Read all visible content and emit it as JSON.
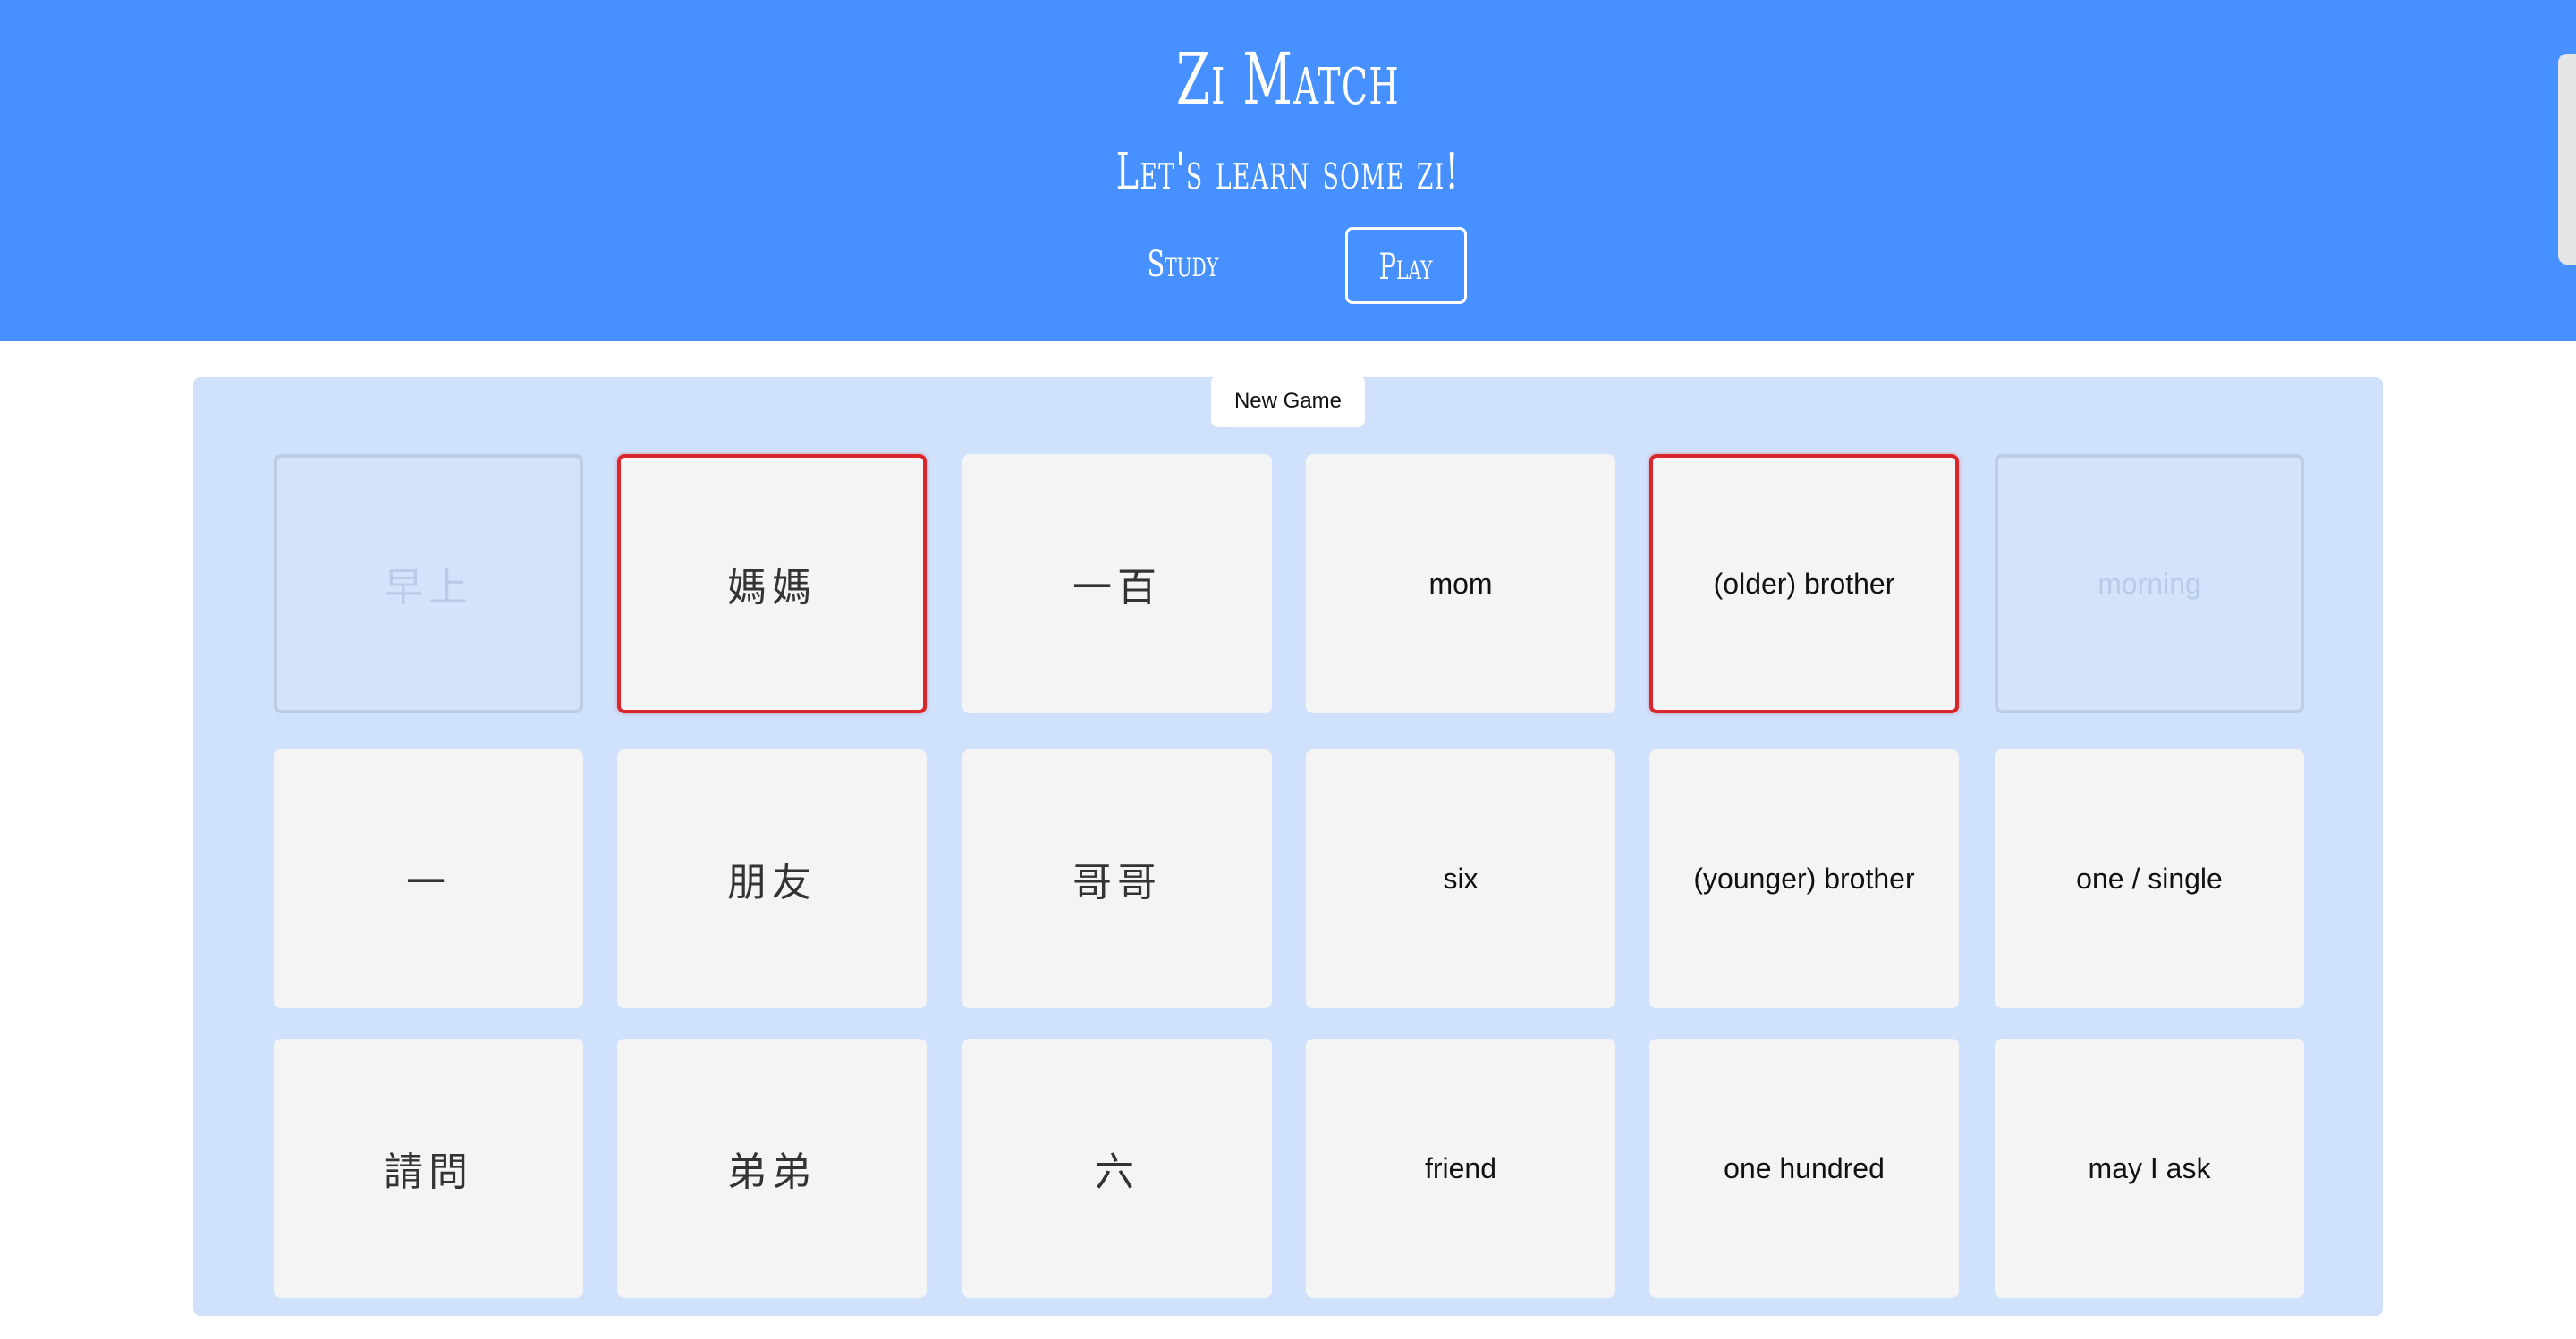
{
  "header": {
    "title": "Zi Match",
    "subtitle": "Let's learn some zi!",
    "nav": {
      "study": "Study",
      "play": "Play"
    }
  },
  "game": {
    "new_game_label": "New Game",
    "cards": [
      {
        "text": "早上",
        "lang": "zh",
        "state": "matched"
      },
      {
        "text": "媽媽",
        "lang": "zh",
        "state": "selected"
      },
      {
        "text": "一百",
        "lang": "zh",
        "state": "normal"
      },
      {
        "text": "mom",
        "lang": "en",
        "state": "normal"
      },
      {
        "text": "(older) brother",
        "lang": "en",
        "state": "selected"
      },
      {
        "text": "morning",
        "lang": "en",
        "state": "matched"
      },
      {
        "text": "一",
        "lang": "zh",
        "state": "normal"
      },
      {
        "text": "朋友",
        "lang": "zh",
        "state": "normal"
      },
      {
        "text": "哥哥",
        "lang": "zh",
        "state": "normal"
      },
      {
        "text": "six",
        "lang": "en",
        "state": "normal"
      },
      {
        "text": "(younger) brother",
        "lang": "en",
        "state": "normal"
      },
      {
        "text": "one / single",
        "lang": "en",
        "state": "normal"
      },
      {
        "text": "請問",
        "lang": "zh",
        "state": "normal"
      },
      {
        "text": "弟弟",
        "lang": "zh",
        "state": "normal"
      },
      {
        "text": "六",
        "lang": "zh",
        "state": "normal"
      },
      {
        "text": "friend",
        "lang": "en",
        "state": "normal"
      },
      {
        "text": "one hundred",
        "lang": "en",
        "state": "normal"
      },
      {
        "text": "may I ask",
        "lang": "en",
        "state": "normal"
      }
    ]
  },
  "colors": {
    "header_bg": "#4790ff",
    "board_bg": "#cfe1fb",
    "card_bg": "#f4f4f4",
    "selected_border": "#d9262c",
    "matched_bg": "#d2e3fb"
  }
}
